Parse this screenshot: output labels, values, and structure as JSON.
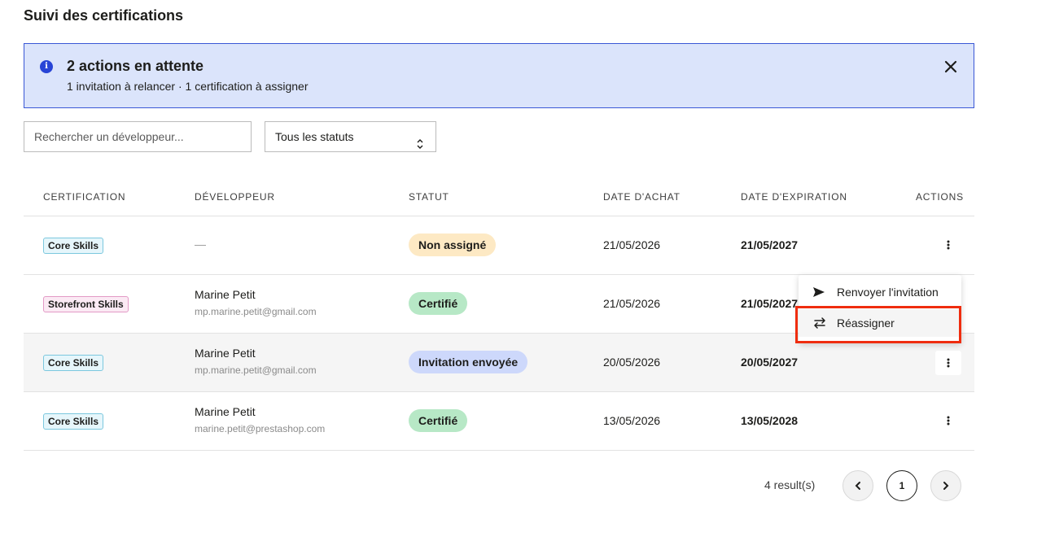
{
  "page": {
    "title": "Suivi des certifications"
  },
  "alert": {
    "title": "2 actions en attente",
    "subtitle": "1 invitation à relancer · 1 certification à assigner"
  },
  "filters": {
    "search_placeholder": "Rechercher un développeur...",
    "status_selected": "Tous les statuts"
  },
  "table": {
    "columns": [
      "CERTIFICATION",
      "DÉVELOPPEUR",
      "STATUT",
      "DATE D'ACHAT",
      "DATE D'EXPIRATION",
      "ACTIONS"
    ],
    "rows": [
      {
        "certification": "Core Skills",
        "developer_name": "—",
        "developer_email": "",
        "status": "Non assigné",
        "purchase_date": "21/05/2026",
        "expiration_date": "21/05/2027"
      },
      {
        "certification": "Storefront Skills",
        "developer_name": "Marine Petit",
        "developer_email": "mp.marine.petit@gmail.com",
        "status": "Certifié",
        "purchase_date": "21/05/2026",
        "expiration_date": "21/05/2027"
      },
      {
        "certification": "Core Skills",
        "developer_name": "Marine Petit",
        "developer_email": "mp.marine.petit@gmail.com",
        "status": "Invitation envoyée",
        "purchase_date": "20/05/2026",
        "expiration_date": "20/05/2027"
      },
      {
        "certification": "Core Skills",
        "developer_name": "Marine Petit",
        "developer_email": "marine.petit@prestashop.com",
        "status": "Certifié",
        "purchase_date": "13/05/2026",
        "expiration_date": "13/05/2028"
      }
    ]
  },
  "actions_menu": {
    "items": [
      {
        "label": "Renvoyer l'invitation",
        "icon": "send-icon"
      },
      {
        "label": "Réassigner",
        "icon": "swap-arrows-icon"
      }
    ]
  },
  "pagination": {
    "results": "4 result(s)",
    "current_page": "1"
  },
  "colors": {
    "alert_bg": "#dbe4fb",
    "alert_border": "#3a57d6",
    "highlight": "#ef2d0f"
  }
}
